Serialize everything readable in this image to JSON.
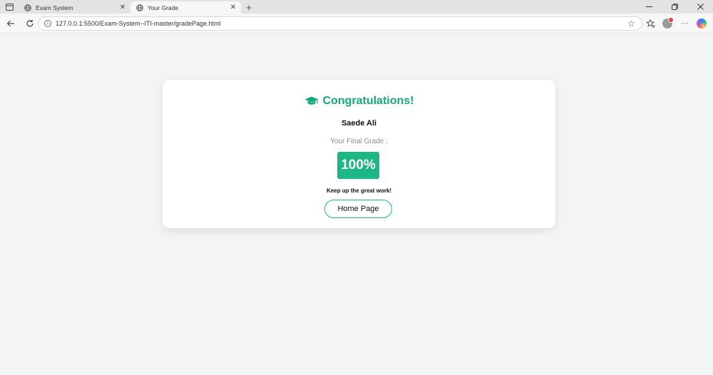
{
  "browser": {
    "tabs": [
      {
        "title": "Exam System",
        "active": false
      },
      {
        "title": "Your Grade",
        "active": true
      }
    ],
    "address": {
      "url": "127.0.0.1:5500/Exam-System--ITI-master/gradePage.html"
    },
    "colors": {
      "tabstrip": "#e3e3e3",
      "toolbar": "#f7f7f7"
    }
  },
  "page": {
    "headline": "Congratulations!",
    "student_name": "Saede Ali",
    "grade_label": "Your Final Grade :",
    "grade_value": "100%",
    "message": "Keep up the great work!",
    "home_button": "Home Page",
    "colors": {
      "accent": "#1db685",
      "headline": "#17a77a",
      "background": "#f3f5f5"
    },
    "icons": {
      "headline": "graduation-cap-icon"
    }
  }
}
